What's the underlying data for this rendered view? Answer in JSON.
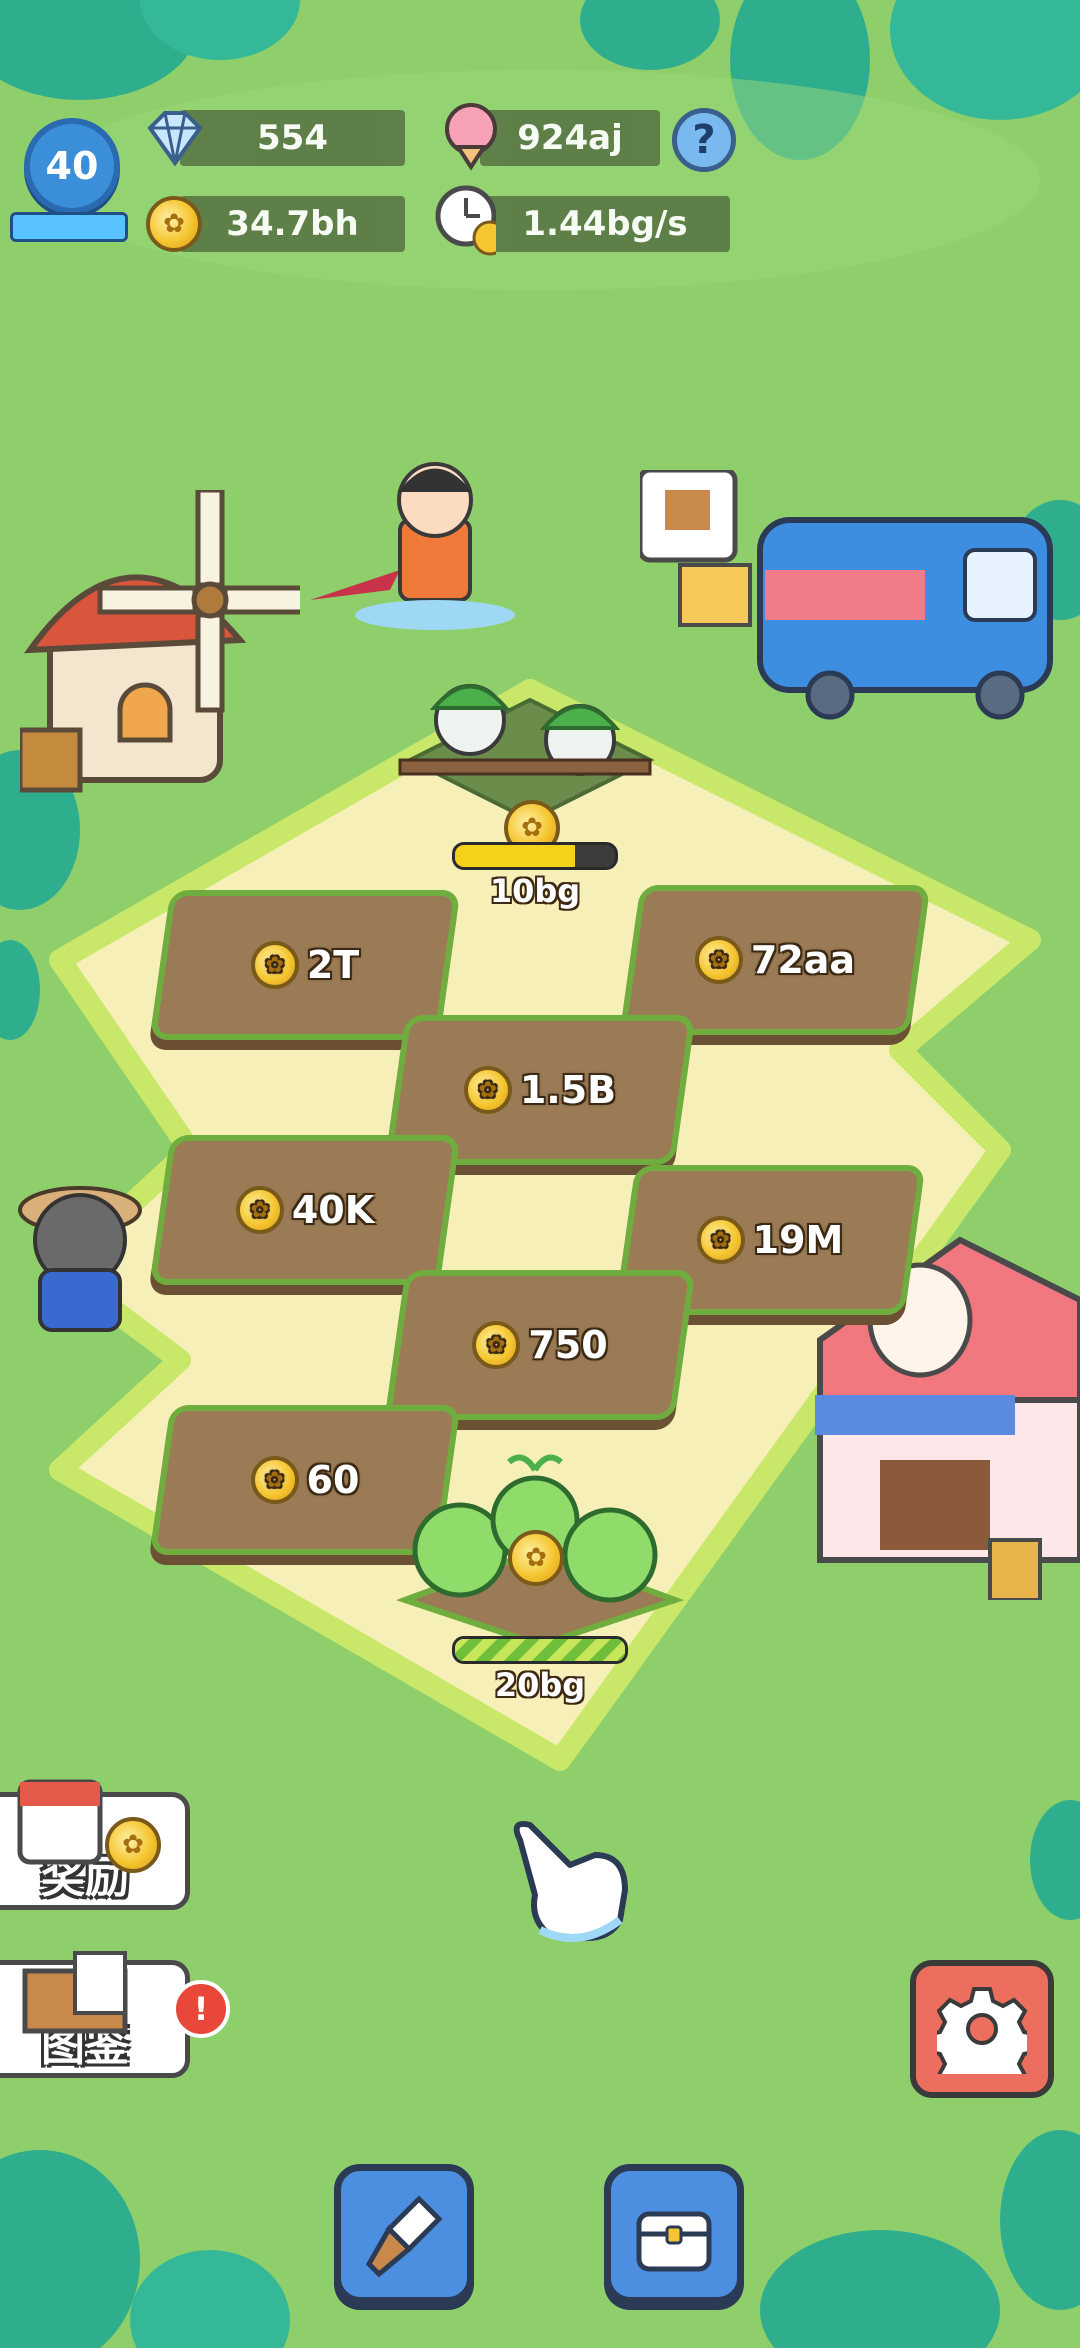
{
  "hud": {
    "level": "40",
    "level_progress": 1.0,
    "gems": "554",
    "ice_cream": "924aj",
    "coins": "34.7bh",
    "coin_rate": "1.44bg/s",
    "help_label": "?"
  },
  "plots": {
    "top_crop_cost": "10bg",
    "top_crop_progress": 0.75,
    "plot_2t": "2T",
    "plot_72aa": "72aa",
    "plot_15b": "1.5B",
    "plot_40k": "40K",
    "plot_19m": "19M",
    "plot_750": "750",
    "plot_60": "60",
    "bottom_crop_cost": "20bg",
    "bottom_crop_progress": 1.0
  },
  "side": {
    "rewards_label": "奖励",
    "collection_label": "图鉴",
    "collection_alert": "!"
  },
  "colors": {
    "grass": "#8fcf6b",
    "path": "#f6efb7",
    "soil": "#9a7b55",
    "accent_blue": "#4c8fe0",
    "settings_red": "#ec6e5e"
  },
  "icons": [
    "gem-icon",
    "ice-cream-icon",
    "coin-icon",
    "timer-coin-icon",
    "help-icon",
    "gear-icon",
    "shovel-icon",
    "chest-icon",
    "pointing-hand-icon",
    "windmill-icon",
    "food-truck-icon",
    "ice-cream-shop-icon"
  ]
}
